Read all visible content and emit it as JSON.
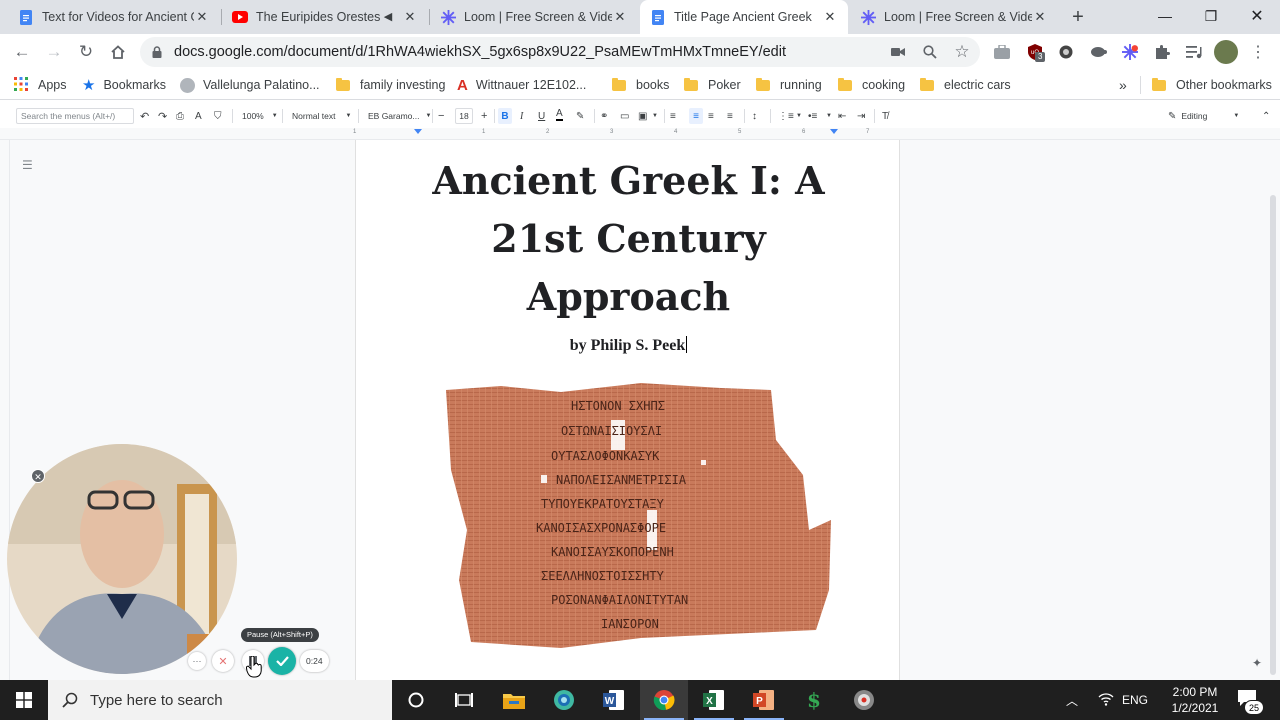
{
  "browser": {
    "tabs": [
      {
        "title": "Text for Videos for Ancient Gr",
        "favicon": "docs-icon",
        "active": false,
        "muted": false
      },
      {
        "title": "The Euripides Orestes C",
        "favicon": "youtube-icon",
        "active": false,
        "muted": true
      },
      {
        "title": "Loom | Free Screen & Video",
        "favicon": "loom-icon",
        "active": false,
        "muted": false
      },
      {
        "title": "Title Page Ancient Greek",
        "favicon": "docs-icon",
        "active": true,
        "muted": false
      },
      {
        "title": "Loom | Free Screen & Video",
        "favicon": "loom-icon",
        "active": false,
        "muted": false
      }
    ],
    "new_tab": "+",
    "url": "docs.google.com/document/d/1RhWA4wiekhSX_5gx6sp8x9U22_PsaMEwTmHMxTmneEY/edit",
    "extension_badge": "3",
    "bookmarks": [
      {
        "label": "Apps",
        "icon": "apps-grid-icon"
      },
      {
        "label": "Bookmarks",
        "icon": "star-icon"
      },
      {
        "label": "Vallelunga Palatino...",
        "icon": "globe-icon"
      },
      {
        "label": "family investing",
        "icon": "folder-icon"
      },
      {
        "label": "Wittnauer 12E102...",
        "icon": "pdf-icon"
      },
      {
        "label": "books",
        "icon": "folder-icon"
      },
      {
        "label": "Poker",
        "icon": "folder-icon"
      },
      {
        "label": "running",
        "icon": "folder-icon"
      },
      {
        "label": "cooking",
        "icon": "folder-icon"
      },
      {
        "label": "electric cars",
        "icon": "folder-icon"
      }
    ],
    "more_bookmarks": "»",
    "other_bookmarks": "Other bookmarks"
  },
  "docs_toolbar": {
    "search_placeholder": "Search the menus (Alt+/)",
    "zoom": "100%",
    "style": "Normal text",
    "font": "EB Garamo...",
    "font_size": "18",
    "mode": "Editing"
  },
  "ruler": {
    "ticks": [
      "1",
      "1",
      "2",
      "3",
      "4",
      "5",
      "6",
      "7"
    ]
  },
  "document": {
    "title": "Ancient Greek I: A 21st Century Approach",
    "title_lines": [
      "Ancient Greek I: A",
      "21st Century",
      "Approach"
    ],
    "author": "by Philip S. Peek",
    "image_alt": "papyrus-fragment"
  },
  "loom": {
    "tooltip": "Pause (Alt+Shift+P)",
    "timer": "0:24",
    "more": "···"
  },
  "taskbar": {
    "search_placeholder": "Type here to search",
    "language": "ENG",
    "time": "2:00 PM",
    "date": "1/2/2021",
    "notification_count": "25"
  },
  "colors": {
    "tab_strip": "#dee1e6",
    "loom_accent": "#625df5",
    "loom_check": "#1ab3a6",
    "papyrus": "#c97a5b"
  }
}
